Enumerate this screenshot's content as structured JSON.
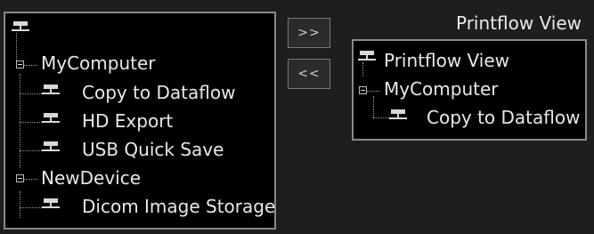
{
  "left_tree": {
    "root_icon": "computer-network-icon",
    "nodes": [
      {
        "label": "MyComputer",
        "type": "group"
      },
      {
        "label": "Copy to Dataflow",
        "type": "device"
      },
      {
        "label": "HD Export",
        "type": "device"
      },
      {
        "label": "USB Quick Save",
        "type": "device"
      },
      {
        "label": "NewDevice",
        "type": "group"
      },
      {
        "label": "Dicom Image Storage",
        "type": "device"
      }
    ]
  },
  "buttons": {
    "add_label": ">>",
    "remove_label": "<<"
  },
  "right_panel": {
    "title": "Printflow View",
    "nodes": [
      {
        "label": "Printflow View",
        "type": "root"
      },
      {
        "label": "MyComputer",
        "type": "group"
      },
      {
        "label": "Copy to Dataflow",
        "type": "device"
      }
    ]
  }
}
